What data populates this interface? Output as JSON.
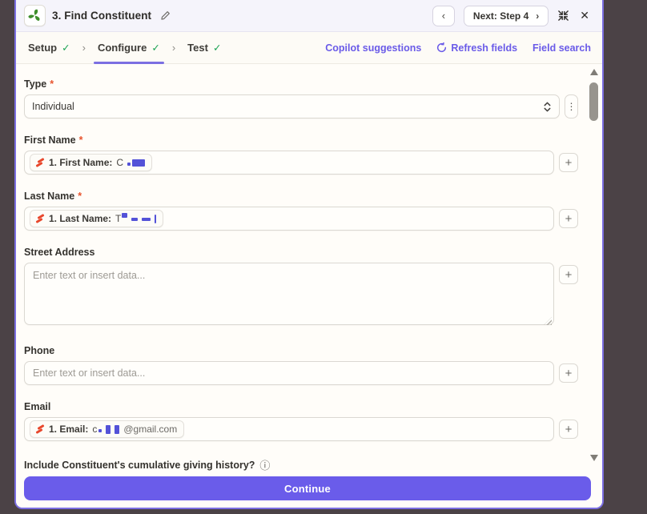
{
  "glyphs": {
    "check": "✓",
    "separator": "›",
    "back": "‹",
    "next_chevron": "›",
    "close": "✕",
    "dots_menu": "⋮",
    "plus": "+",
    "info": "ⓘ",
    "asterisk": "*"
  },
  "header": {
    "title": "3. Find Constituent",
    "next_button": "Next: Step 4"
  },
  "tabbar": {
    "tabs": [
      {
        "label": "Setup"
      },
      {
        "label": "Configure"
      },
      {
        "label": "Test"
      }
    ],
    "copilot": "Copilot suggestions",
    "refresh": "Refresh fields",
    "field_search": "Field search"
  },
  "form": {
    "type": {
      "label": "Type",
      "value": "Individual"
    },
    "first_name": {
      "label": "First Name",
      "token_label": "1. First Name:",
      "token_value": "C"
    },
    "last_name": {
      "label": "Last Name",
      "token_label": "1. Last Name:",
      "token_value": "T"
    },
    "street_address": {
      "label": "Street Address",
      "placeholder": "Enter text or insert data..."
    },
    "phone": {
      "label": "Phone",
      "placeholder": "Enter text or insert data..."
    },
    "email": {
      "label": "Email",
      "token_label": "1. Email:",
      "token_value": "c",
      "token_tail": "@gmail.com"
    },
    "giving_history": {
      "label": "Include Constituent's cumulative giving history?"
    }
  },
  "footer": {
    "continue": "Continue"
  },
  "colors": {
    "accent_purple": "#6a5cea",
    "backdrop": "#4b4246",
    "check_green": "#18a251",
    "required_orange": "#e8542e",
    "redaction_blue": "#5352d8",
    "token_icon_orange": "#e8472c",
    "logo_green": "#3e8e2c"
  }
}
